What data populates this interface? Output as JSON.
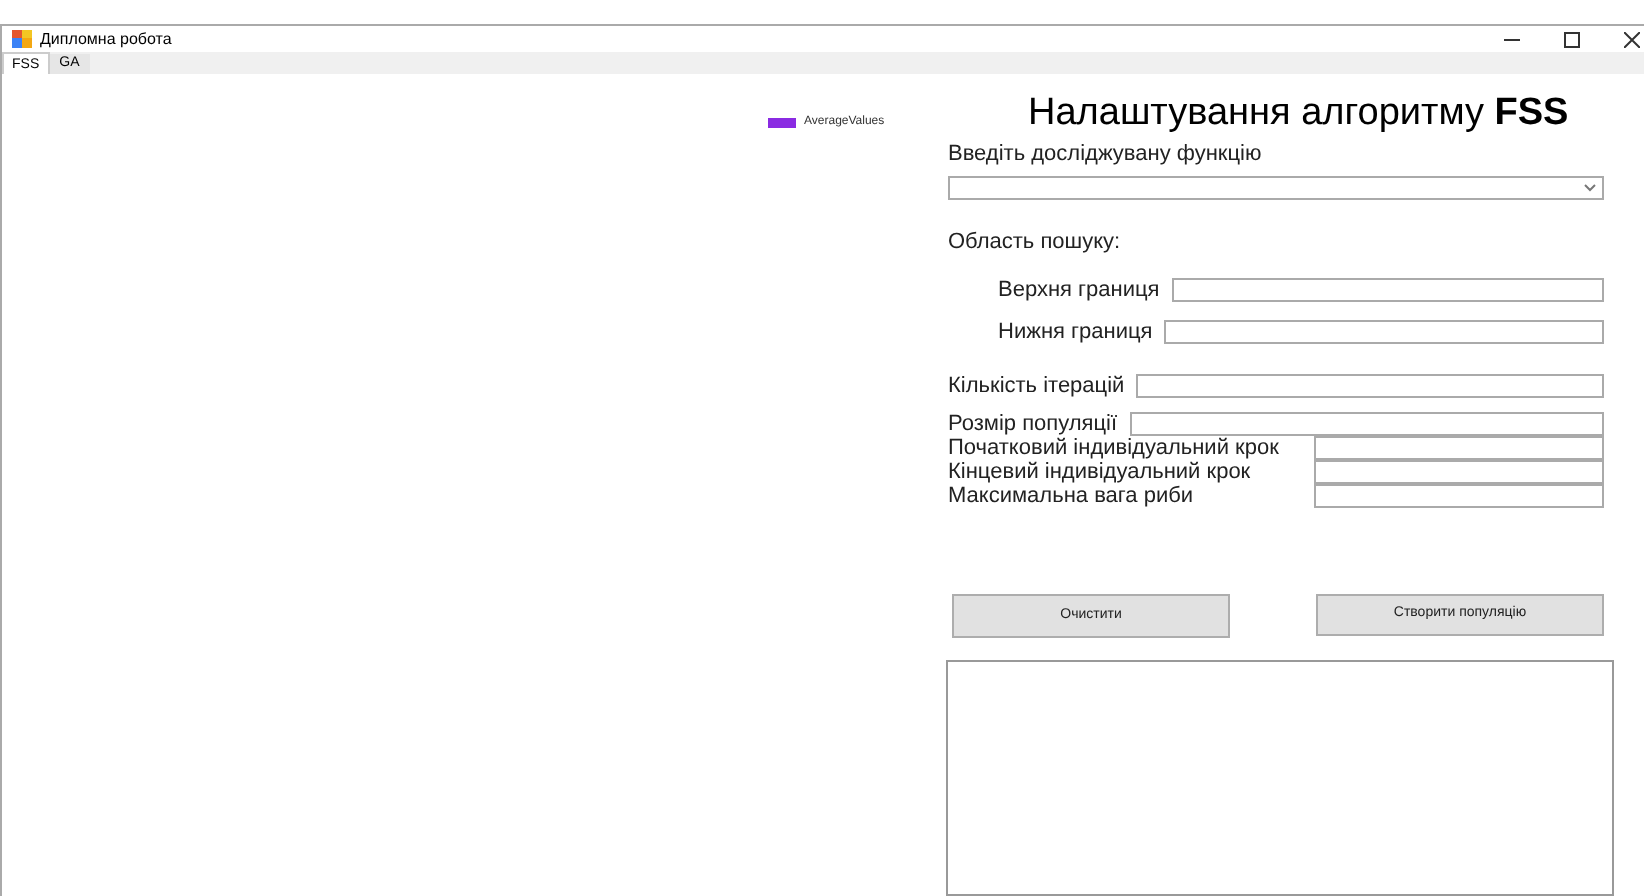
{
  "window": {
    "title": "Дипломна робота"
  },
  "tabs": [
    {
      "label": "FSS",
      "selected": true
    },
    {
      "label": "GA",
      "selected": false
    }
  ],
  "chart": {
    "legend": [
      {
        "label": "AverageValues",
        "color": "#8a2be2"
      }
    ]
  },
  "settings": {
    "heading": "Налаштування алгоритму **FSS**",
    "function_label": "Введіть досліджувану функцію",
    "search_area_label": "Область пошуку:",
    "bounds": [
      {
        "label": "Верхня границя"
      },
      {
        "label": "Нижня границя"
      }
    ],
    "params": [
      {
        "label": "Кількість ітерацій"
      },
      {
        "label": "Розмір популяції"
      },
      {
        "label": "Початковий індивідуальний крок"
      },
      {
        "label": "Кінцевий індивідуальний крок"
      },
      {
        "label": "Максимальна вага риби"
      }
    ],
    "buttons": [
      "Очистити",
      "Створити популяцію"
    ]
  }
}
